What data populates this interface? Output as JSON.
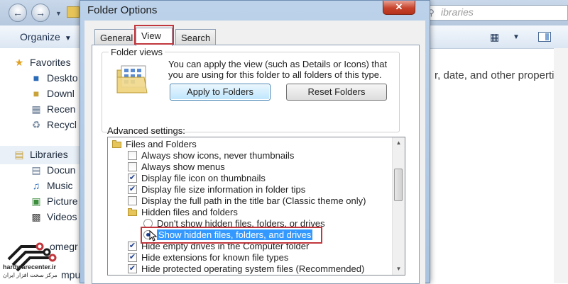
{
  "explorer": {
    "search_placeholder": "ibraries",
    "organize_label": "Organize",
    "nav": {
      "favorites": "Favorites",
      "desktop": "Deskto",
      "downloads": "Downl",
      "recent": "Recen",
      "recycle": "Recycl",
      "libraries": "Libraries",
      "documents": "Docun",
      "music": "Music",
      "pictures": "Picture",
      "videos": "Videos",
      "homegroup": "omegr",
      "computer": "mput"
    },
    "pane_text": "r, date, and other properties."
  },
  "watermark": {
    "site": "hardwarecenter.ir",
    "tagline": "مرکز سخت افزار ایران"
  },
  "dialog": {
    "title": "Folder Options",
    "close_glyph": "✕",
    "tabs": [
      {
        "label": "General"
      },
      {
        "label": "View"
      },
      {
        "label": "Search"
      }
    ],
    "folder_views": {
      "legend": "Folder views",
      "description": "You can apply the view (such as Details or Icons) that you are using for this folder to all folders of this type.",
      "apply_button": "Apply to Folders",
      "reset_button": "Reset Folders"
    },
    "advanced_label": "Advanced settings:",
    "settings": [
      {
        "type": "folder",
        "label": "Files and Folders"
      },
      {
        "type": "checkbox",
        "checked": false,
        "label": "Always show icons, never thumbnails"
      },
      {
        "type": "checkbox",
        "checked": false,
        "label": "Always show menus"
      },
      {
        "type": "checkbox",
        "checked": true,
        "label": "Display file icon on thumbnails"
      },
      {
        "type": "checkbox",
        "checked": true,
        "label": "Display file size information in folder tips"
      },
      {
        "type": "checkbox",
        "checked": false,
        "label": "Display the full path in the title bar (Classic theme only)"
      },
      {
        "type": "folder",
        "label": "Hidden files and folders"
      },
      {
        "type": "radio",
        "checked": false,
        "label": "Don't show hidden files, folders, or drives"
      },
      {
        "type": "radio",
        "checked": true,
        "label": "Show hidden files, folders, and drives"
      },
      {
        "type": "checkbox",
        "checked": true,
        "label": "Hide empty drives in the Computer folder"
      },
      {
        "type": "checkbox",
        "checked": true,
        "label": "Hide extensions for known file types"
      },
      {
        "type": "checkbox",
        "checked": true,
        "label": "Hide protected operating system files (Recommended)"
      }
    ]
  },
  "colors": {
    "highlight_box": "#c0373d",
    "selection": "#3399ff"
  }
}
